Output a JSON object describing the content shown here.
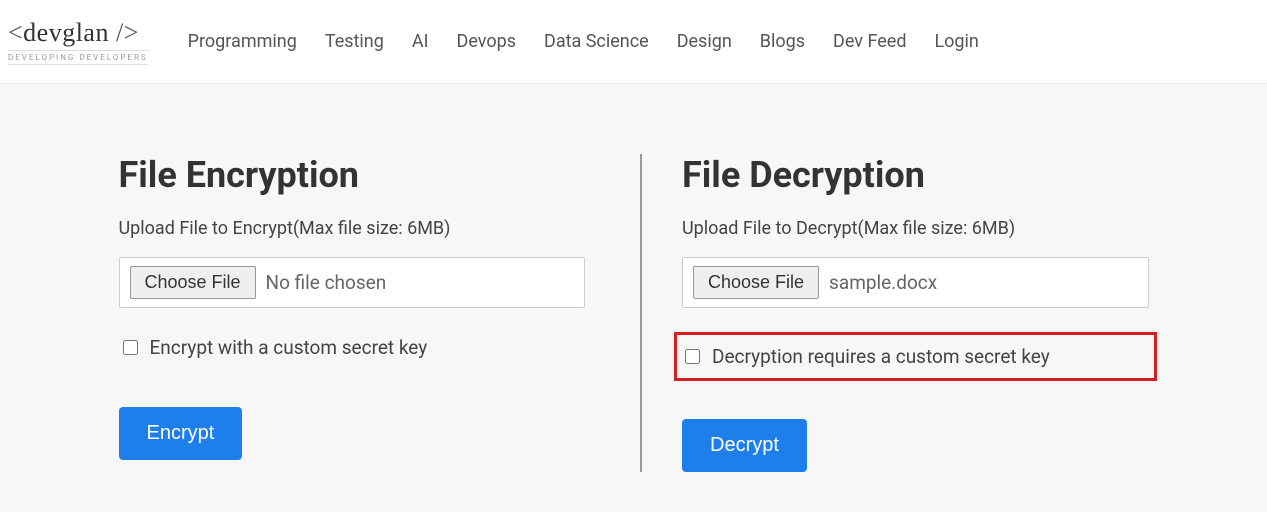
{
  "logo": {
    "text": "<devglan />",
    "tagline": "DEVELOPING DEVELOPERS"
  },
  "nav": {
    "items": [
      "Programming",
      "Testing",
      "AI",
      "Devops",
      "Data Science",
      "Design",
      "Blogs",
      "Dev Feed",
      "Login"
    ]
  },
  "encrypt": {
    "title": "File Encryption",
    "subtitle": "Upload File to Encrypt(Max file size: 6MB)",
    "chooseFileLabel": "Choose File",
    "fileStatus": "No file chosen",
    "checkboxLabel": "Encrypt with a custom secret key",
    "buttonLabel": "Encrypt"
  },
  "decrypt": {
    "title": "File Decryption",
    "subtitle": "Upload File to Decrypt(Max file size: 6MB)",
    "chooseFileLabel": "Choose File",
    "fileStatus": "sample.docx",
    "checkboxLabel": "Decryption requires a custom secret key",
    "buttonLabel": "Decrypt"
  }
}
